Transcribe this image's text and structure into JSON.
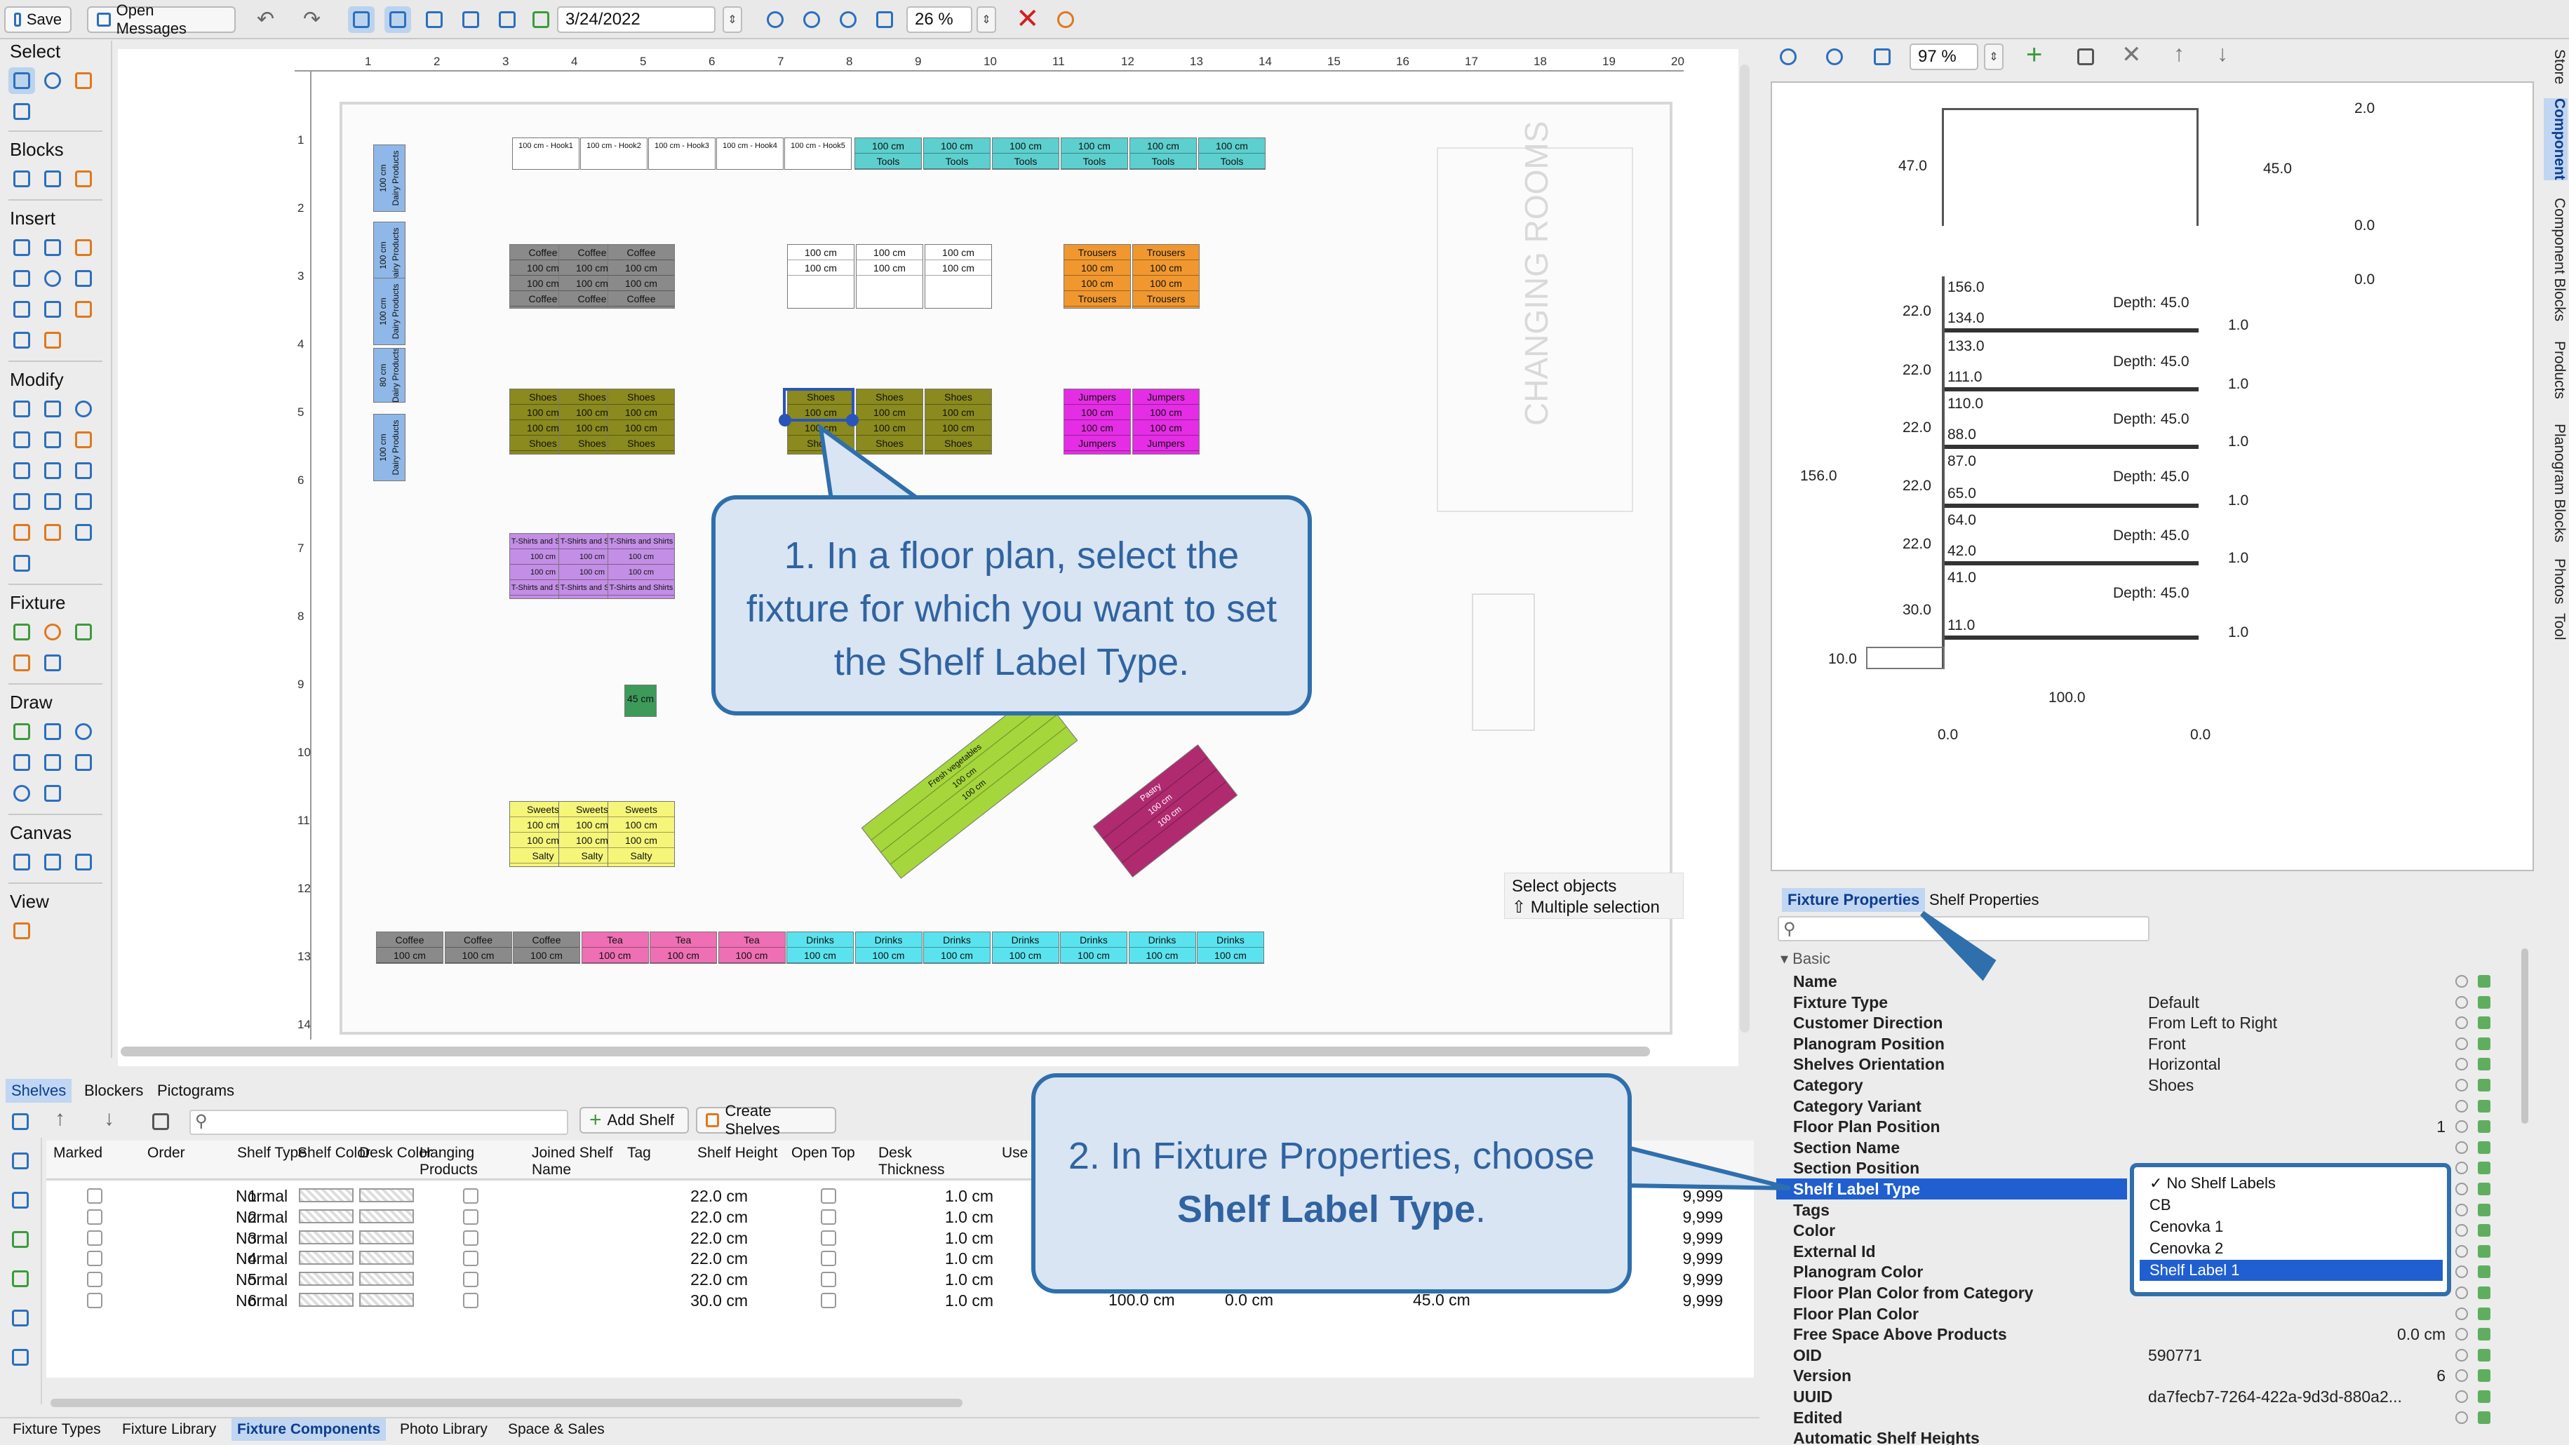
{
  "toolbar": {
    "save": "Save",
    "open_messages": "Open Messages",
    "date": "3/24/2022",
    "zoom": "26 %"
  },
  "left_sections": {
    "select": "Select",
    "blocks": "Blocks",
    "insert": "Insert",
    "modify": "Modify",
    "fixture": "Fixture",
    "draw": "Draw",
    "canvas": "Canvas",
    "view": "View"
  },
  "ruler_h": [
    "1",
    "2",
    "3",
    "4",
    "5",
    "6",
    "7",
    "8",
    "9",
    "10",
    "11",
    "12",
    "13",
    "14",
    "15",
    "16",
    "17",
    "18",
    "19",
    "20"
  ],
  "ruler_v": [
    "1",
    "2",
    "3",
    "4",
    "5",
    "6",
    "7",
    "8",
    "9",
    "10",
    "11",
    "12",
    "13",
    "14"
  ],
  "floor": {
    "changing_rooms": "CHANGING ROOMS",
    "wall_dairy": [
      [
        "100 cm",
        "Dairy Products"
      ],
      [
        "100 cm",
        "Dairy Products"
      ],
      [
        "100 cm",
        "Dairy Products"
      ],
      [
        "80 cm",
        "Dairy Products"
      ],
      [
        "100 cm",
        "Dairy Products"
      ]
    ],
    "top_hooks": [
      "100 cm - Hook1",
      "100 cm - Hook2",
      "100 cm - Hook3",
      "100 cm - Hook4",
      "100 cm - Hook5"
    ],
    "tools": [
      [
        "100 cm",
        "Tools"
      ],
      [
        "100 cm",
        "Tools"
      ],
      [
        "100 cm",
        "Tools"
      ],
      [
        "100 cm",
        "Tools"
      ],
      [
        "100 cm",
        "Tools"
      ],
      [
        "100 cm",
        "Tools"
      ]
    ],
    "coffee": [
      [
        "Coffee",
        "100 cm",
        "100 cm",
        "Coffee"
      ],
      [
        "Coffee",
        "100 cm",
        "100 cm",
        "Coffee"
      ],
      [
        "Coffee",
        "100 cm",
        "100 cm",
        "Coffee"
      ]
    ],
    "blank": [
      [
        "100 cm",
        "100 cm"
      ],
      [
        "100 cm",
        "100 cm"
      ],
      [
        "100 cm",
        "100 cm"
      ]
    ],
    "trousers": [
      [
        "Trousers",
        "100 cm",
        "100 cm",
        "Trousers"
      ],
      [
        "Trousers",
        "100 cm",
        "100 cm",
        "Trousers"
      ]
    ],
    "shoes_a": [
      [
        "Shoes",
        "100 cm",
        "100 cm",
        "Shoes"
      ],
      [
        "Shoes",
        "100 cm",
        "100 cm",
        "Shoes"
      ],
      [
        "Shoes",
        "100 cm",
        "100 cm",
        "Shoes"
      ]
    ],
    "shoes_b": [
      [
        "Shoes",
        "100 cm",
        "100 cm",
        "Shoes"
      ],
      [
        "Shoes",
        "100 cm",
        "100 cm",
        "Shoes"
      ],
      [
        "Shoes",
        "100 cm",
        "100 cm",
        "Shoes"
      ]
    ],
    "jumpers": [
      [
        "Jumpers",
        "100 cm",
        "100 cm",
        "Jumpers"
      ],
      [
        "Jumpers",
        "100 cm",
        "100 cm",
        "Jumpers"
      ]
    ],
    "tshirts": [
      [
        "T-Shirts and Shirts",
        "100 cm",
        "100 cm",
        "T-Shirts and Shirts"
      ],
      [
        "T-Shirts and Shirts",
        "100 cm",
        "100 cm",
        "T-Shirts and Shirts"
      ],
      [
        "T-Shirts and Shirts",
        "100 cm",
        "100 cm",
        "T-Shirts and Shirts"
      ]
    ],
    "small": "45 cm",
    "sweets": [
      [
        "Sweets",
        "100 cm",
        "100 cm",
        "Salty"
      ],
      [
        "Sweets",
        "100 cm",
        "100 cm",
        "Salty"
      ],
      [
        "Sweets",
        "100 cm",
        "100 cm",
        "Salty"
      ]
    ],
    "bottom_row": [
      [
        "Coffee",
        "100 cm"
      ],
      [
        "Coffee",
        "100 cm"
      ],
      [
        "Coffee",
        "100 cm"
      ],
      [
        "Tea",
        "100 cm"
      ],
      [
        "Tea",
        "100 cm"
      ],
      [
        "Tea",
        "100 cm"
      ],
      [
        "Drinks",
        "100 cm"
      ],
      [
        "Drinks",
        "100 cm"
      ],
      [
        "Drinks",
        "100 cm"
      ],
      [
        "Drinks",
        "100 cm"
      ],
      [
        "Drinks",
        "100 cm"
      ],
      [
        "Drinks",
        "100 cm"
      ],
      [
        "Drinks",
        "100 cm"
      ]
    ],
    "green_diag": [
      "Fresh vegetables",
      "100 cm",
      "100 cm"
    ],
    "pastry": [
      "Pastry",
      "100 cm",
      "100 cm"
    ]
  },
  "status": {
    "line1": "Select objects",
    "line2": "⇧ Multiple selection"
  },
  "callout1": "1. In a floor plan, select the fixture for which you want to set the Shelf Label Type.",
  "callout2": {
    "pre": "2. In Fixture Properties, choose ",
    "bold": "Shelf Label Type",
    "post": "."
  },
  "bottom": {
    "tabs": [
      "Shelves",
      "Blockers",
      "Pictograms"
    ],
    "add_shelf": "Add Shelf",
    "create_shelves": "Create Shelves",
    "headers": [
      "Marked",
      "Order",
      "Shelf Type",
      "Shelf Color",
      "Desk Color",
      "Hanging Products",
      "Joined Shelf Name",
      "Tag",
      "Shelf Height",
      "Open Top",
      "Desk Thickness",
      "Use Leng"
    ],
    "rows": [
      {
        "order": "1",
        "type": "Normal",
        "height": "22.0 cm",
        "desk": "1.0 cm",
        "cap": "9,999"
      },
      {
        "order": "2",
        "type": "Normal",
        "height": "22.0 cm",
        "desk": "1.0 cm",
        "cap": "9,999"
      },
      {
        "order": "3",
        "type": "Normal",
        "height": "22.0 cm",
        "desk": "1.0 cm",
        "cap": "9,999"
      },
      {
        "order": "4",
        "type": "Normal",
        "height": "22.0 cm",
        "desk": "1.0 cm",
        "cap": "9,999"
      },
      {
        "order": "5",
        "type": "Normal",
        "height": "22.0 cm",
        "desk": "1.0 cm",
        "cap": "9,999"
      },
      {
        "order": "6",
        "type": "Normal",
        "height": "30.0 cm",
        "desk": "1.0 cm",
        "cap": "9,999"
      }
    ],
    "row6_extra": [
      "100.0 cm",
      "0.0 cm",
      "45.0 cm"
    ],
    "bottom_tabs": [
      "Fixture Types",
      "Fixture Library",
      "Fixture Components",
      "Photo Library",
      "Space & Sales"
    ]
  },
  "right": {
    "zoom": "97 %",
    "elev_top": {
      "a": "2.0",
      "b": "47.0",
      "c": "45.0",
      "d": "0.0",
      "e": "0.0"
    },
    "elev_left": [
      "22.0",
      "22.0",
      "22.0",
      "22.0",
      "22.0",
      "30.0"
    ],
    "total": "156.0",
    "base": "10.0",
    "width": "100.0",
    "z1": "0.0",
    "z2": "0.0",
    "shelves": [
      {
        "top": "156.0",
        "bot": "134.0",
        "depth": "Depth: 45.0",
        "r": "1.0"
      },
      {
        "top": "133.0",
        "bot": "111.0",
        "depth": "Depth: 45.0",
        "r": "1.0"
      },
      {
        "top": "110.0",
        "bot": "88.0",
        "depth": "Depth: 45.0",
        "r": "1.0"
      },
      {
        "top": "87.0",
        "bot": "65.0",
        "depth": "Depth: 45.0",
        "r": "1.0"
      },
      {
        "top": "64.0",
        "bot": "42.0",
        "depth": "Depth: 45.0",
        "r": "1.0"
      },
      {
        "top": "41.0",
        "bot": "11.0",
        "depth": "Depth: 45.0",
        "r": "1.0"
      }
    ],
    "tabs": [
      "Fixture Properties",
      "Shelf Properties"
    ],
    "basic": "Basic",
    "props": [
      {
        "k": "Name",
        "v": ""
      },
      {
        "k": "Fixture Type",
        "v": "Default"
      },
      {
        "k": "Customer Direction",
        "v": "From Left to Right"
      },
      {
        "k": "Planogram Position",
        "v": "Front"
      },
      {
        "k": "Shelves Orientation",
        "v": "Horizontal"
      },
      {
        "k": "Category",
        "v": "Shoes"
      },
      {
        "k": "Category Variant",
        "v": ""
      },
      {
        "k": "Floor Plan Position",
        "v": "1"
      },
      {
        "k": "Section Name",
        "v": ""
      },
      {
        "k": "Section Position",
        "v": ""
      },
      {
        "k": "Shelf Label Type",
        "v": ""
      },
      {
        "k": "Tags",
        "v": ""
      },
      {
        "k": "Color",
        "v": ""
      },
      {
        "k": "External Id",
        "v": ""
      },
      {
        "k": "Planogram Color",
        "v": ""
      },
      {
        "k": "Floor Plan Color from Category",
        "v": ""
      },
      {
        "k": "Floor Plan Color",
        "v": ""
      },
      {
        "k": "Free Space Above Products",
        "v": "0.0 cm"
      },
      {
        "k": "OID",
        "v": "590771"
      },
      {
        "k": "Version",
        "v": "6"
      },
      {
        "k": "UUID",
        "v": "da7fecb7-7264-422a-9d3d-880a2..."
      },
      {
        "k": "Edited",
        "v": ""
      },
      {
        "k": "Automatic Shelf Heights",
        "v": ""
      }
    ],
    "dropdown": [
      "✓ No Shelf Labels",
      "CB",
      "Cenovka 1",
      "Cenovka 2",
      "Shelf Label 1"
    ],
    "vtabs": [
      "Store",
      "Component",
      "Component Blocks",
      "Products",
      "Planogram Blocks",
      "Photos",
      "Tool"
    ]
  }
}
